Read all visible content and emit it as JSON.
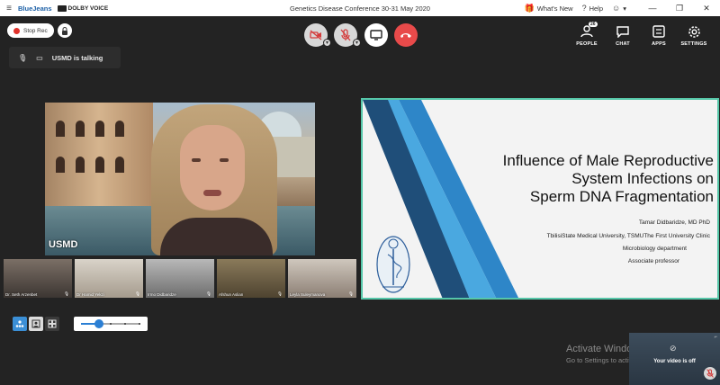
{
  "titlebar": {
    "app_brand": "BlueJeans",
    "dolby_label": "DOLBY VOICE",
    "window_title": "Genetics Disease Conference 30-31 May 2020",
    "whats_new": "What's New",
    "help": "Help",
    "user_menu_caret": "▾"
  },
  "controls": {
    "stop_rec": "Stop Rec",
    "people_badge": "26",
    "people": "PEOPLE",
    "chat": "CHAT",
    "apps": "APPS",
    "settings": "SETTINGS"
  },
  "talking": {
    "text": "USMD is talking"
  },
  "main_video": {
    "name": "USMD"
  },
  "slide": {
    "title_lines": [
      "Influence of Male Reproductive",
      "System Infections on",
      "Sperm DNA Fragmentation"
    ],
    "author": "Tamar Didbaridze, MD PhD",
    "affiliation": "TbilisiState Medical University, TSMUThe First University Clinic",
    "department": "Microbiology department",
    "position": "Associate professor",
    "stripe_colors": [
      "#1f4e79",
      "#2e86c8",
      "#4aa8e0"
    ]
  },
  "thumbnails": [
    {
      "name": "Dr. Seth Arzenbet",
      "mic": "🎙"
    },
    {
      "name": "Dr Hamid Yekzi",
      "mic": "🎙"
    },
    {
      "name": "Irmo Didbaridze",
      "mic": "🎙"
    },
    {
      "name": "Afshun Aslian",
      "mic": "🎙"
    },
    {
      "name": "Leyla Suleymanova",
      "mic": "🎙"
    }
  ],
  "layout": {
    "slider_fraction": 0.3
  },
  "watermark": {
    "line1": "Activate Windows",
    "line2": "Go to Settings to activate Windows."
  },
  "self_video": {
    "status": "Your video is off"
  }
}
